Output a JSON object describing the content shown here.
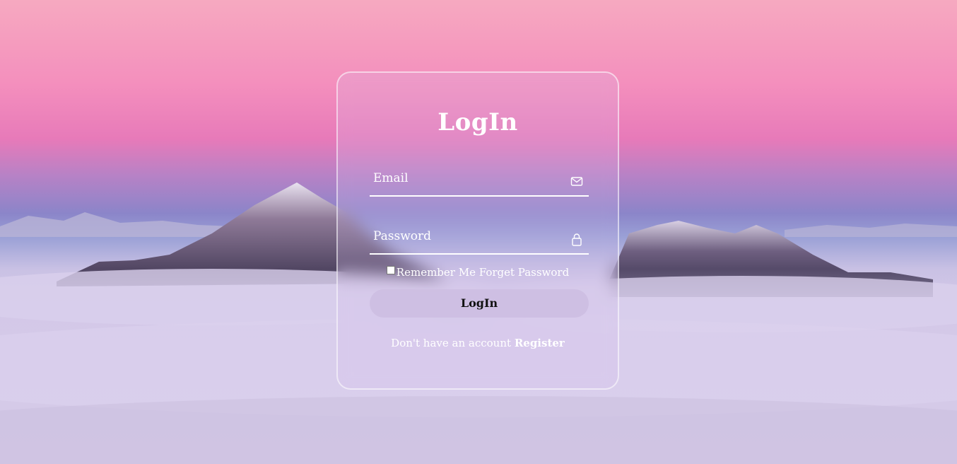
{
  "login_form": {
    "title": "LogIn",
    "email_placeholder": "Email",
    "password_placeholder": "Password",
    "remember_label": "Remember Me",
    "forget_password": "Forget Password",
    "submit_label": "LogIn",
    "no_account_text": "Don't have an account",
    "register_link": "Register"
  },
  "icons": {
    "email": "envelope-icon",
    "password": "lock-icon"
  },
  "colors": {
    "text": "#ffffff",
    "button_bg": "#cdbee1",
    "sky_top": "#f6a9c0",
    "sky_mid": "#e77ab9",
    "clouds": "#d8cdea"
  }
}
